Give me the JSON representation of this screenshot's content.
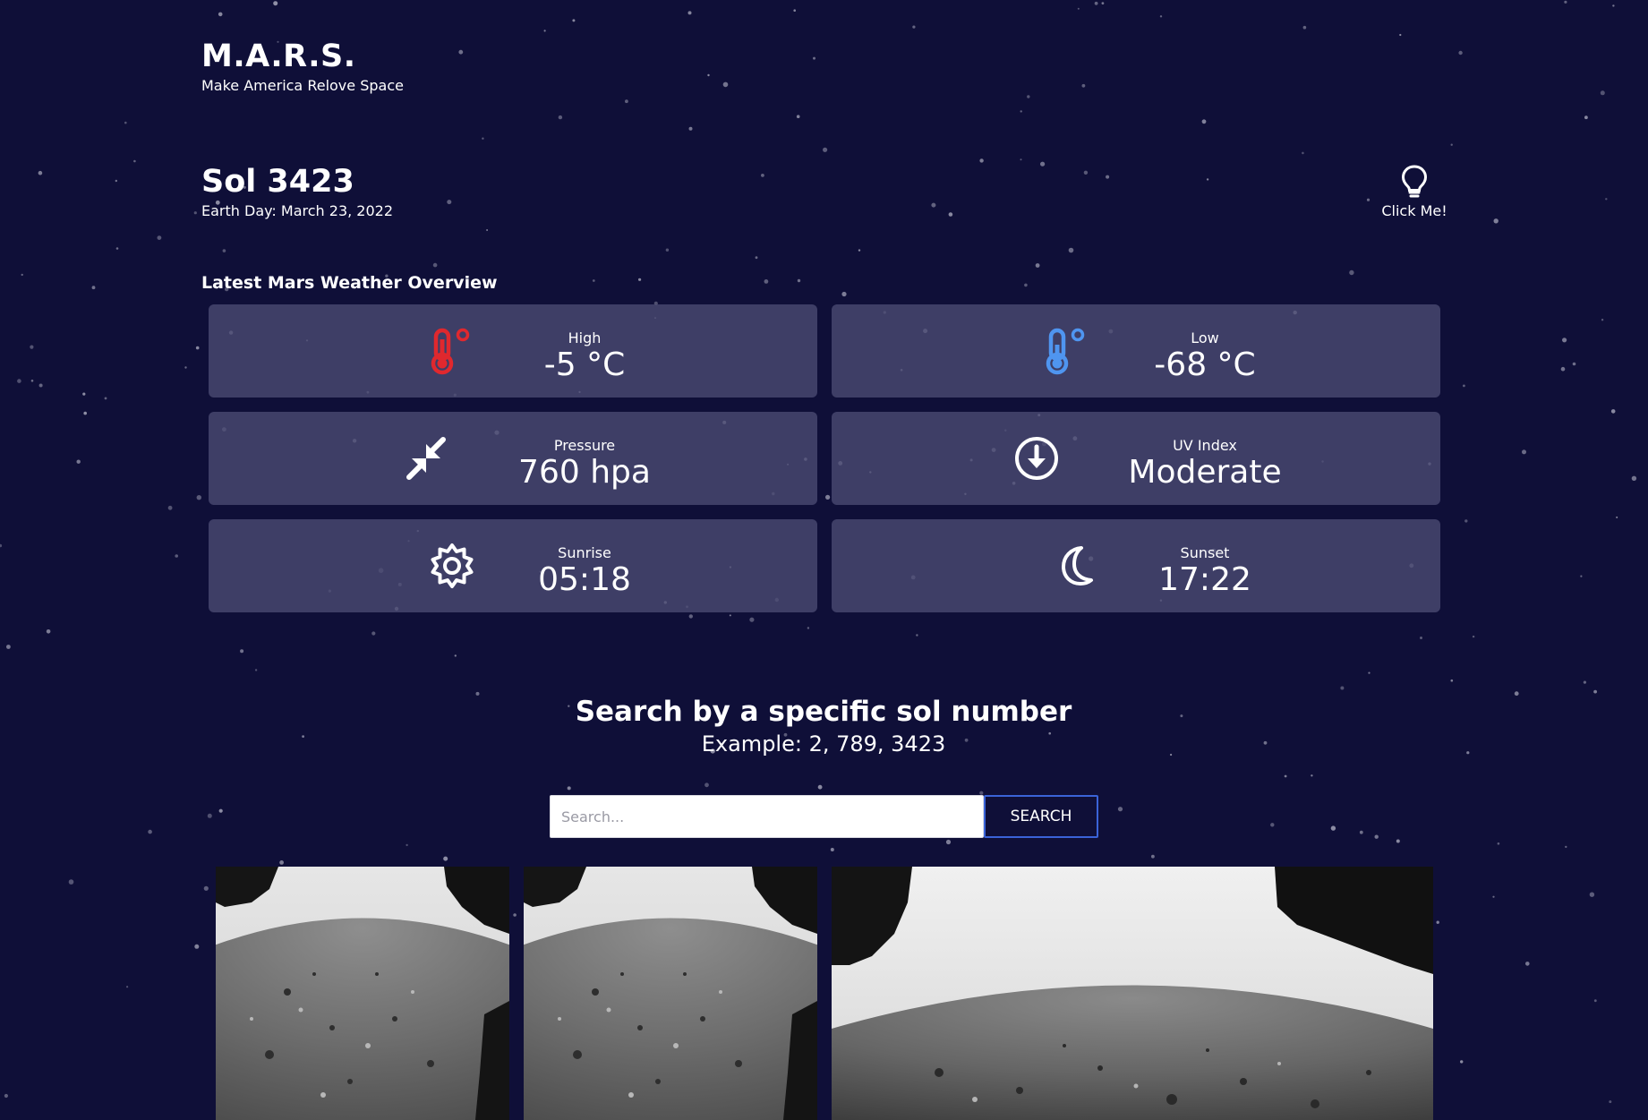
{
  "brand": {
    "title": "M.A.R.S.",
    "subtitle": "Make America Relove Space"
  },
  "sol": {
    "title": "Sol 3423",
    "earth_day": "Earth Day: March 23, 2022"
  },
  "hint": {
    "label": "Click Me!",
    "icon": "lightbulb-icon"
  },
  "overview": {
    "title": "Latest Mars Weather Overview",
    "cards": [
      {
        "label": "High",
        "value": "-5 °C",
        "icon": "thermometer-icon",
        "color": "#e0282e"
      },
      {
        "label": "Low",
        "value": "-68 °C",
        "icon": "thermometer-icon",
        "color": "#4f95f0"
      },
      {
        "label": "Pressure",
        "value": "760 hpa",
        "icon": "compress-arrows-icon"
      },
      {
        "label": "UV Index",
        "value": "Moderate",
        "icon": "arrow-circle-down-icon"
      },
      {
        "label": "Sunrise",
        "value": "05:18",
        "icon": "sun-icon"
      },
      {
        "label": "Sunset",
        "value": "17:22",
        "icon": "moon-icon"
      }
    ]
  },
  "search": {
    "title": "Search by a specific sol number",
    "example": "Example: 2, 789, 3423",
    "placeholder": "Search...",
    "button_label": "SEARCH"
  },
  "colors": {
    "background": "#0f0f38",
    "card": "#4b4b73",
    "button_border": "#3a63d8"
  }
}
